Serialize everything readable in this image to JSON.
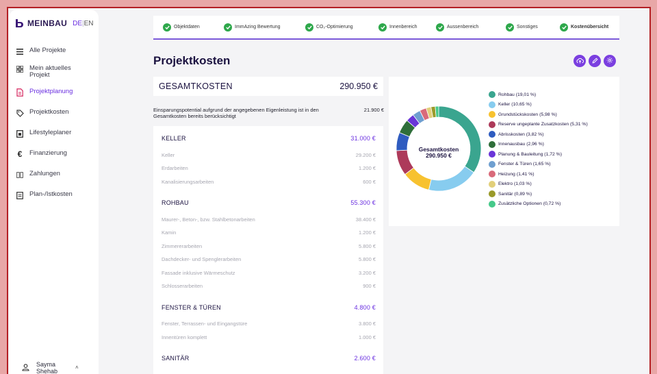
{
  "sidebar": {
    "logo": "MEINBAU",
    "lang_de": "DE",
    "lang_sep": "|",
    "lang_en": "EN",
    "items": [
      {
        "label": "Alle Projekte"
      },
      {
        "label": "Mein aktuelles Projekt"
      },
      {
        "label": "Projektplanung"
      },
      {
        "label": "Projektkosten"
      },
      {
        "label": "Lifestyleplaner"
      },
      {
        "label": "Finanzierung"
      },
      {
        "label": "Zahlungen"
      },
      {
        "label": "Plan-/Istkosten"
      }
    ],
    "user_first": "Sayma",
    "user_last": "Shehab"
  },
  "stepper": [
    {
      "label": "Objektdaten"
    },
    {
      "label": "ImmAzing Bewertung"
    },
    {
      "label": "CO₂-Optimierung"
    },
    {
      "label": "Innenbereich"
    },
    {
      "label": "Aussenbereich"
    },
    {
      "label": "Sonstiges"
    },
    {
      "label": "Kostenübersicht"
    }
  ],
  "page": {
    "title": "Projektkosten",
    "total_label": "GESAMTKOSTEN",
    "total_value": "290.950 €",
    "savings_text": "Einsparungspotential aufgrund der angegebenen Eigenleistung ist in den Gesamtkosten bereits berücksichtigt",
    "savings_value": "21.900 €"
  },
  "categories": [
    {
      "name": "KELLER",
      "total": "31.000 €",
      "rows": [
        {
          "label": "Keller",
          "value": "29.200 €"
        },
        {
          "label": "Erdarbeiten",
          "value": "1.200 €"
        },
        {
          "label": "Kanalisierungsarbeiten",
          "value": "600 €"
        }
      ]
    },
    {
      "name": "ROHBAU",
      "total": "55.300 €",
      "rows": [
        {
          "label": "Maurer-, Beton-, bzw. Stahlbetonarbeiten",
          "value": "38.400 €"
        },
        {
          "label": "Kamin",
          "value": "1.200 €"
        },
        {
          "label": "Zimmererarbeiten",
          "value": "5.800 €"
        },
        {
          "label": "Dachdecker- und Spenglerarbeiten",
          "value": "5.800 €"
        },
        {
          "label": "Fassade inklusive Wärmeschutz",
          "value": "3.200 €"
        },
        {
          "label": "Schlosserarbeiten",
          "value": "900 €"
        }
      ]
    },
    {
      "name": "FENSTER & TÜREN",
      "total": "4.800 €",
      "rows": [
        {
          "label": "Fenster, Terrassen- und Eingangstüre",
          "value": "3.800 €"
        },
        {
          "label": "Innentüren komplett",
          "value": "1.000 €"
        }
      ]
    },
    {
      "name": "SANITÄR",
      "total": "2.600 €",
      "rows": []
    }
  ],
  "chart_data": {
    "type": "pie",
    "center_label": "Gesamtkosten",
    "center_value": "290.950 €",
    "series": [
      {
        "name": "Rohbau (19,01 %)",
        "value": 19.01,
        "color": "#3aa58f"
      },
      {
        "name": "Keller (10,65 %)",
        "value": 10.65,
        "color": "#87ccef"
      },
      {
        "name": "Grundstückskosten (5,98 %)",
        "value": 5.98,
        "color": "#f7c230"
      },
      {
        "name": "Reserve ungeplante Zusatzkosten (5,31 %)",
        "value": 5.31,
        "color": "#ad3a5a"
      },
      {
        "name": "Abrisskosten (3,82 %)",
        "value": 3.82,
        "color": "#2f5cc0"
      },
      {
        "name": "Innenausbau (2,96 %)",
        "value": 2.96,
        "color": "#2f6e3a"
      },
      {
        "name": "Planung & Bauleitung (1,72 %)",
        "value": 1.72,
        "color": "#6a35d8"
      },
      {
        "name": "Fenster & Türen (1,65 %)",
        "value": 1.65,
        "color": "#6f9fd0"
      },
      {
        "name": "Heizung (1,41 %)",
        "value": 1.41,
        "color": "#d96a7a"
      },
      {
        "name": "Elektro (1,03 %)",
        "value": 1.03,
        "color": "#e2cf7a"
      },
      {
        "name": "Sanitär (0,89 %)",
        "value": 0.89,
        "color": "#9a9a2a"
      },
      {
        "name": "Zusätzliche Optionen (0,72 %)",
        "value": 0.72,
        "color": "#46c98a"
      }
    ]
  }
}
